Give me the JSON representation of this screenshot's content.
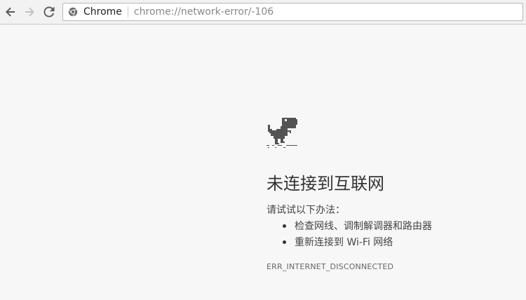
{
  "browser": {
    "scheme_label": "Chrome",
    "url": "chrome://network-error/-106"
  },
  "error_page": {
    "title": "未连接到互联网",
    "suggestions_heading": "请试试以下办法：",
    "suggestions": [
      "检查网线、调制解调器和路由器",
      "重新连接到 Wi-Fi 网络"
    ],
    "error_code": "ERR_INTERNET_DISCONNECTED"
  },
  "icons": {
    "back": "back-arrow-icon",
    "forward": "forward-arrow-icon",
    "reload": "reload-icon",
    "omnibox": "chrome-logo-icon",
    "error": "offline-dinosaur-icon"
  }
}
